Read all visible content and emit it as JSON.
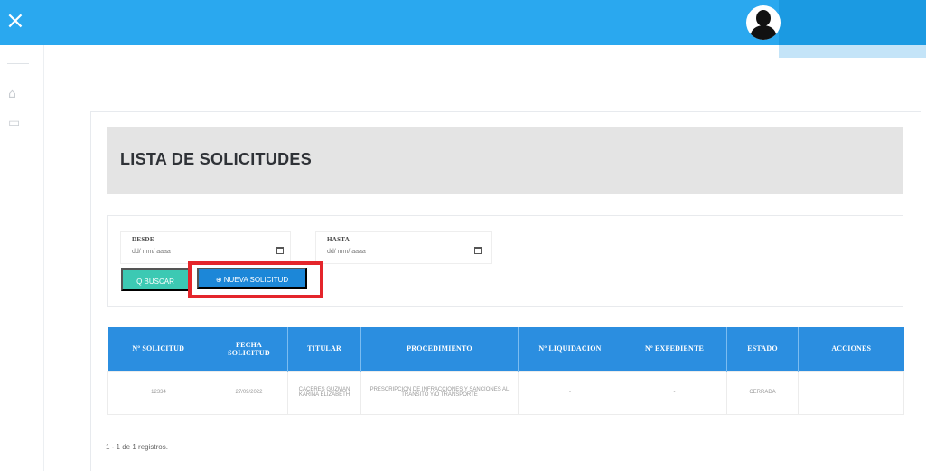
{
  "topbar": {
    "close_symbol": "×",
    "accent": "#2aa8ef"
  },
  "page": {
    "title": "LISTA DE SOLICITUDES"
  },
  "filters": {
    "desde_label": "DESDE",
    "desde_value": "dd/ mm/ aaaa",
    "hasta_label": "HASTA",
    "hasta_value": "dd/ mm/ aaaa"
  },
  "buttons": {
    "buscar_label": "Q BUSCAR",
    "nueva_label": "⊕ NUEVA SOLICITUD"
  },
  "table": {
    "headers": [
      "Nº SOLICITUD",
      "FECHA SOLICITUD",
      "TITULAR",
      "PROCEDIMIENTO",
      "Nº LIQUIDACION",
      "Nº EXPEDIENTE",
      "ESTADO",
      "ACCIONES"
    ],
    "rows": [
      [
        "12334",
        "27/09/2022",
        "CACERES GUZMAN KARINA ELIZABETH",
        "PRESCRIPCION DE INFRACCIONES Y SANCIONES AL TRANSITO Y/O TRANSPORTE",
        "-",
        "-",
        "CERRADA",
        ""
      ]
    ]
  },
  "records_text": "1 - 1 de 1 registros."
}
